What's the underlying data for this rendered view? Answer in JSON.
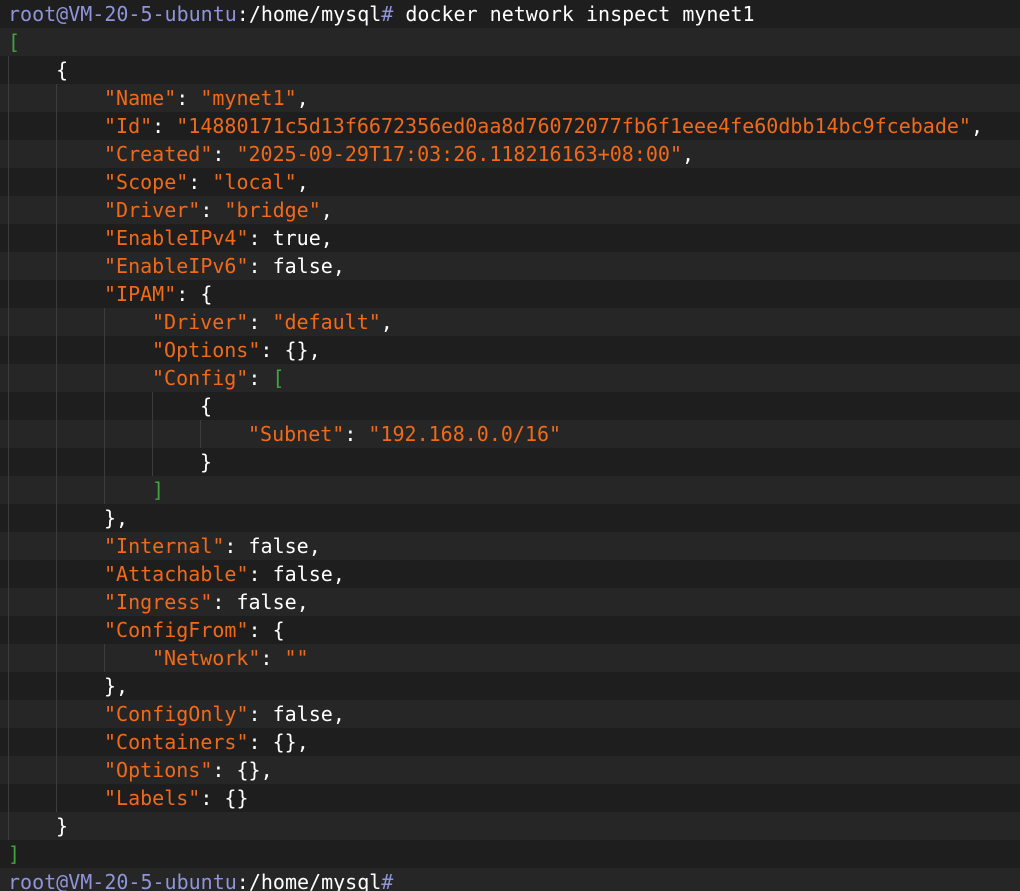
{
  "terminal": {
    "prompt": {
      "user_host": "root@VM-20-5-ubuntu",
      "path": ":/home/mysql",
      "symbol": "#"
    },
    "command": " docker network inspect mynet1",
    "open_bracket": "[",
    "close_bracket": "]",
    "open_brace": "{",
    "close_brace": "}",
    "fields": {
      "name": {
        "key": "\"Name\"",
        "value": "\"mynet1\""
      },
      "id": {
        "key": "\"Id\"",
        "value": "\"14880171c5d13f6672356ed0aa8d76072077fb6f1eee4fe60dbb14bc9fcebade\""
      },
      "created": {
        "key": "\"Created\"",
        "value": "\"2025-09-29T17:03:26.118216163+08:00\""
      },
      "scope": {
        "key": "\"Scope\"",
        "value": "\"local\""
      },
      "driver": {
        "key": "\"Driver\"",
        "value": "\"bridge\""
      },
      "enable_ipv4": {
        "key": "\"EnableIPv4\"",
        "value": "true"
      },
      "enable_ipv6": {
        "key": "\"EnableIPv6\"",
        "value": "false"
      },
      "ipam": {
        "key": "\"IPAM\"",
        "driver": {
          "key": "\"Driver\"",
          "value": "\"default\""
        },
        "options": {
          "key": "\"Options\"",
          "value": "{}"
        },
        "config": {
          "key": "\"Config\"",
          "subnet_key": "\"Subnet\"",
          "subnet_value": "\"192.168.0.0/16\""
        }
      },
      "internal": {
        "key": "\"Internal\"",
        "value": "false"
      },
      "attachable": {
        "key": "\"Attachable\"",
        "value": "false"
      },
      "ingress": {
        "key": "\"Ingress\"",
        "value": "false"
      },
      "config_from": {
        "key": "\"ConfigFrom\"",
        "network_key": "\"Network\"",
        "network_value": "\"\""
      },
      "config_only": {
        "key": "\"ConfigOnly\"",
        "value": "false"
      },
      "containers": {
        "key": "\"Containers\"",
        "value": "{}"
      },
      "options": {
        "key": "\"Options\"",
        "value": "{}"
      },
      "labels": {
        "key": "\"Labels\"",
        "value": "{}"
      }
    }
  },
  "colors": {
    "background": "#1e1e1e",
    "prompt": "#8f94db",
    "json_key_string": "#f06a1a",
    "bracket": "#3fa53f",
    "text": "#ffffff"
  }
}
